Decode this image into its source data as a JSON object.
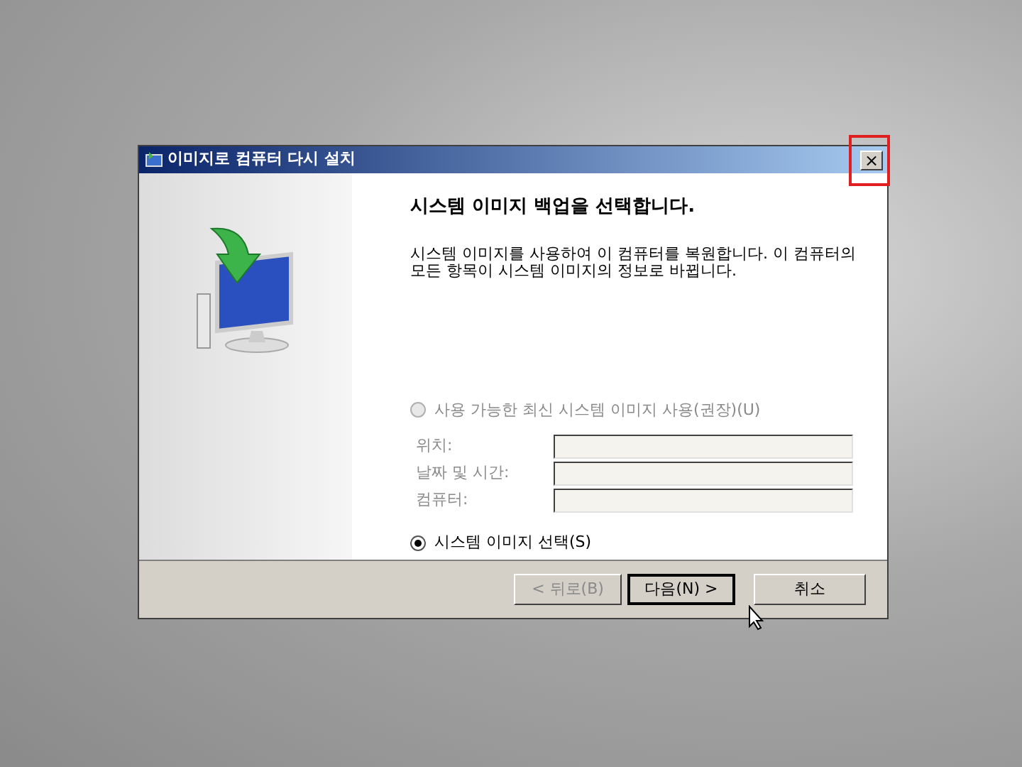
{
  "window": {
    "title": "이미지로 컴퓨터 다시 설치",
    "close": "×"
  },
  "heading": "시스템 이미지 백업을 선택합니다.",
  "description": "시스템 이미지를 사용하여 이 컴퓨터를 복원합니다. 이 컴퓨터의 모든 항목이 시스템 이미지의 정보로 바뀝니다.",
  "options": [
    {
      "label": "사용 가능한 최신 시스템 이미지 사용(권장)(U)",
      "selected": false,
      "disabled": true
    },
    {
      "label": "시스템 이미지 선택(S)",
      "selected": true,
      "disabled": false
    }
  ],
  "fields": [
    {
      "label": "위치:",
      "disabled": true
    },
    {
      "label": "날짜 및 시간:",
      "disabled": true
    },
    {
      "label": "컴퓨터:",
      "disabled": true
    }
  ],
  "buttons": [
    {
      "label": "< 뒤로(B)",
      "disabled": true,
      "default": false
    },
    {
      "label": "다음(N) >",
      "disabled": false,
      "default": true
    },
    {
      "label": "취소",
      "disabled": false,
      "default": false
    }
  ]
}
